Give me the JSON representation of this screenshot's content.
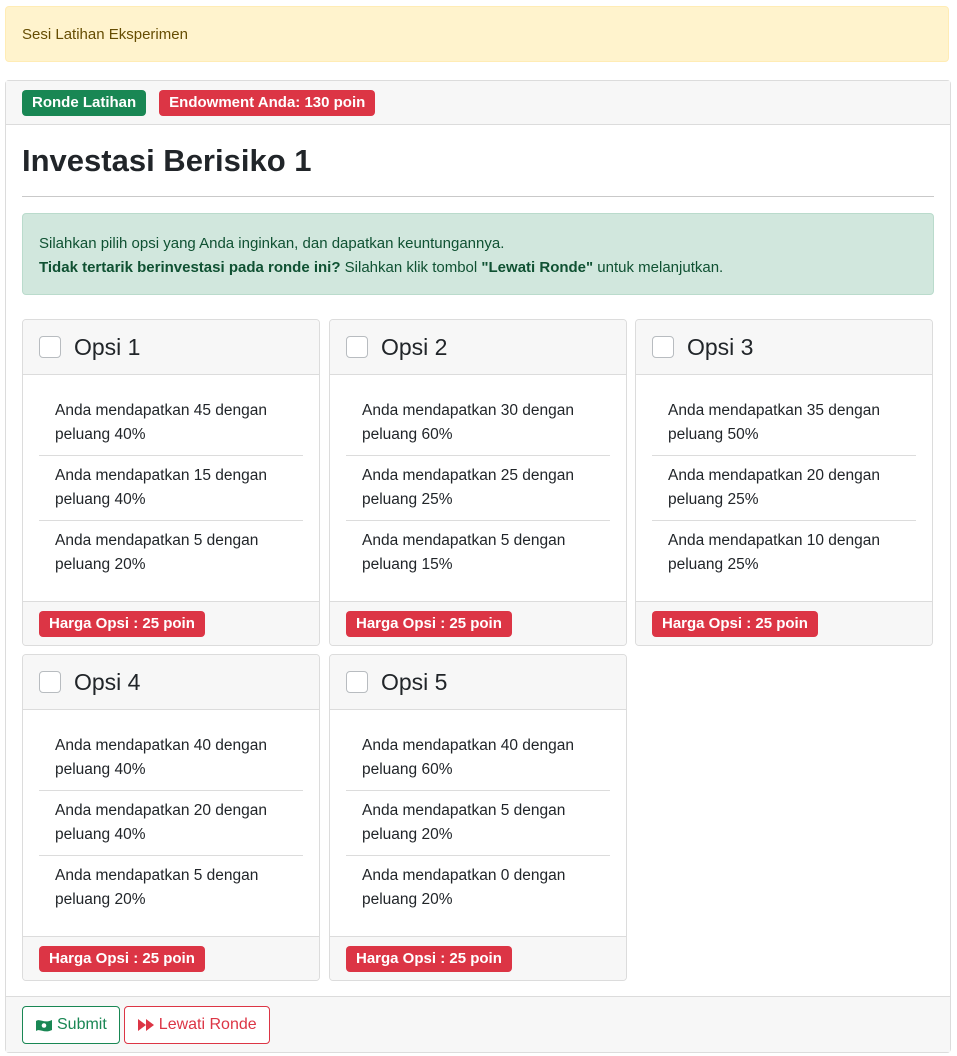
{
  "alert": {
    "text": "Sesi Latihan Eksperimen"
  },
  "header": {
    "round_badge": "Ronde Latihan",
    "endowment_badge": "Endowment Anda: 130 poin"
  },
  "title": "Investasi Berisiko 1",
  "info": {
    "line1": "Silahkan pilih opsi yang Anda inginkan, dan dapatkan keuntungannya.",
    "line2_bold": "Tidak tertarik berinvestasi pada ronde ini?",
    "line2_mid": " Silahkan klik tombol ",
    "line2_button": "\"Lewati Ronde\"",
    "line2_end": " untuk melanjutkan."
  },
  "options": [
    {
      "title": "Opsi 1",
      "items": [
        "Anda mendapatkan 45 dengan peluang 40%",
        "Anda mendapatkan 15 dengan peluang 40%",
        "Anda mendapatkan 5 dengan peluang 20%"
      ],
      "price": "Harga Opsi : 25 poin"
    },
    {
      "title": "Opsi 2",
      "items": [
        "Anda mendapatkan 30 dengan peluang 60%",
        "Anda mendapatkan 25 dengan peluang 25%",
        "Anda mendapatkan 5 dengan peluang 15%"
      ],
      "price": "Harga Opsi : 25 poin"
    },
    {
      "title": "Opsi 3",
      "items": [
        "Anda mendapatkan 35 dengan peluang 50%",
        "Anda mendapatkan 20 dengan peluang 25%",
        "Anda mendapatkan 10 dengan peluang 25%"
      ],
      "price": "Harga Opsi : 25 poin"
    },
    {
      "title": "Opsi 4",
      "items": [
        "Anda mendapatkan 40 dengan peluang 40%",
        "Anda mendapatkan 20 dengan peluang 40%",
        "Anda mendapatkan 5 dengan peluang 20%"
      ],
      "price": "Harga Opsi : 25 poin"
    },
    {
      "title": "Opsi 5",
      "items": [
        "Anda mendapatkan 40 dengan peluang 60%",
        "Anda mendapatkan 5 dengan peluang 20%",
        "Anda mendapatkan 0 dengan peluang 20%"
      ],
      "price": "Harga Opsi : 25 poin"
    }
  ],
  "footer": {
    "submit_label": "Submit",
    "skip_label": "Lewati Ronde",
    "submit_icon": "money-bill-wave-icon",
    "skip_icon": "fast-forward-icon"
  },
  "colors": {
    "success": "#198754",
    "danger": "#dc3545",
    "warning_bg": "#fff3cd",
    "info_bg": "#d1e7dd"
  }
}
